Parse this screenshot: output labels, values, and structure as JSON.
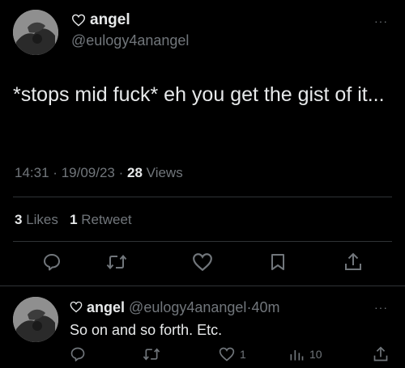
{
  "main_tweet": {
    "author_name": "angel",
    "handle": "@eulogy4anangel",
    "text": "*stops mid fuck* eh you get the gist of it...",
    "time": "14:31",
    "date": "19/09/23",
    "views_count": "28",
    "views_label": "Views",
    "likes_count": "3",
    "likes_label": "Likes",
    "retweets_count": "1",
    "retweets_label": "Retweet",
    "more_label": "···"
  },
  "reply_tweet": {
    "author_name": "angel",
    "handle": "@eulogy4anangel",
    "age": "40m",
    "text": "So on and so forth. Etc.",
    "like_count": "1",
    "views_count": "10",
    "more_label": "···"
  },
  "separators": {
    "dot": "·"
  },
  "icons": {
    "name_prefix": "heart-outline-icon",
    "reply": "reply-bubble-icon",
    "retweet": "retweet-icon",
    "like": "heart-icon",
    "bookmark": "bookmark-icon",
    "share": "share-icon",
    "views": "views-bar-icon"
  },
  "colors": {
    "background": "#000000",
    "primary_text": "#e7e9ea",
    "secondary_text": "#71767b",
    "divider": "#2f3336"
  }
}
